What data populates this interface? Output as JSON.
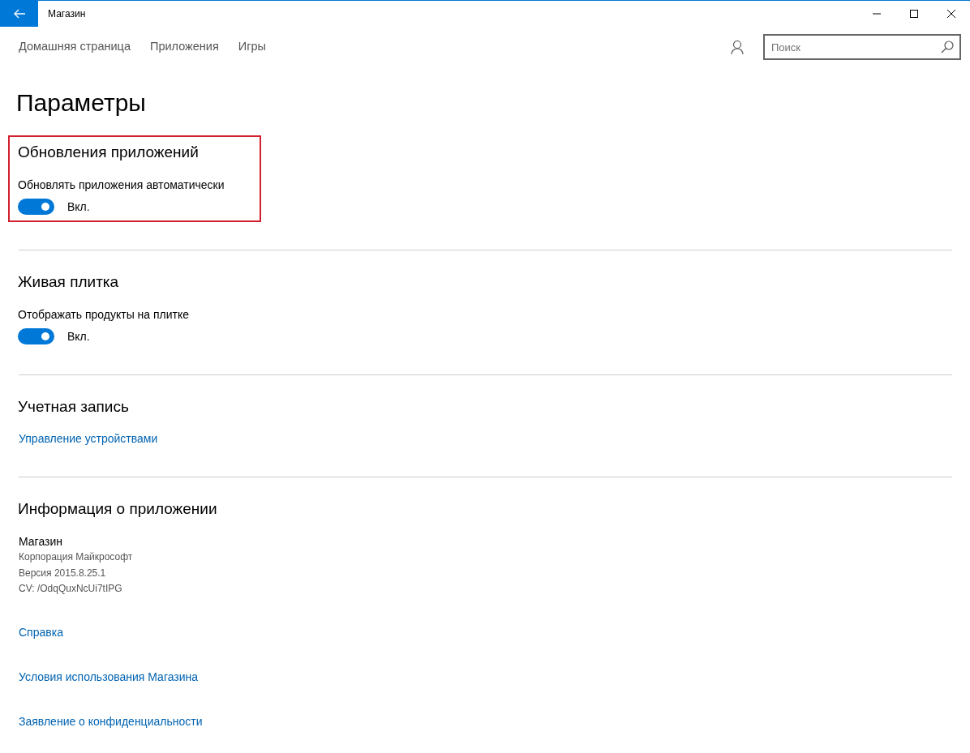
{
  "window": {
    "title": "Магазин"
  },
  "nav": [
    {
      "label": "Домашняя страница",
      "selected": false
    },
    {
      "label": "Приложения",
      "selected": false
    },
    {
      "label": "Игры",
      "selected": false
    }
  ],
  "search": {
    "placeholder": "Поиск"
  },
  "page_title": "Параметры",
  "sections": [
    {
      "title": "Обновления приложений",
      "highlighted": true,
      "items": [
        {
          "kind": "toggle",
          "label": "Обновлять приложения автоматически",
          "on": true,
          "state_text": "Вкл."
        }
      ]
    },
    {
      "title": "Живая плитка",
      "highlighted": false,
      "items": [
        {
          "kind": "toggle",
          "label": "Отображать продукты на плитке",
          "on": true,
          "state_text": "Вкл."
        }
      ]
    },
    {
      "title": "Учетная запись",
      "highlighted": false,
      "items": [
        {
          "kind": "link",
          "label": "Управление устройствами"
        }
      ]
    },
    {
      "title": "Информация о приложении",
      "highlighted": false,
      "items": [
        {
          "kind": "info",
          "lines": [
            "Магазин",
            "Корпорация Майкрософт",
            "Версия 2015.8.25.1",
            "CV: /OdqQuxNcUi7tIPG"
          ]
        },
        {
          "kind": "link",
          "label": "Справка"
        },
        {
          "kind": "link",
          "label": "Условия использования Магазина"
        },
        {
          "kind": "link",
          "label": "Заявление о конфиденциальности"
        }
      ]
    }
  ]
}
